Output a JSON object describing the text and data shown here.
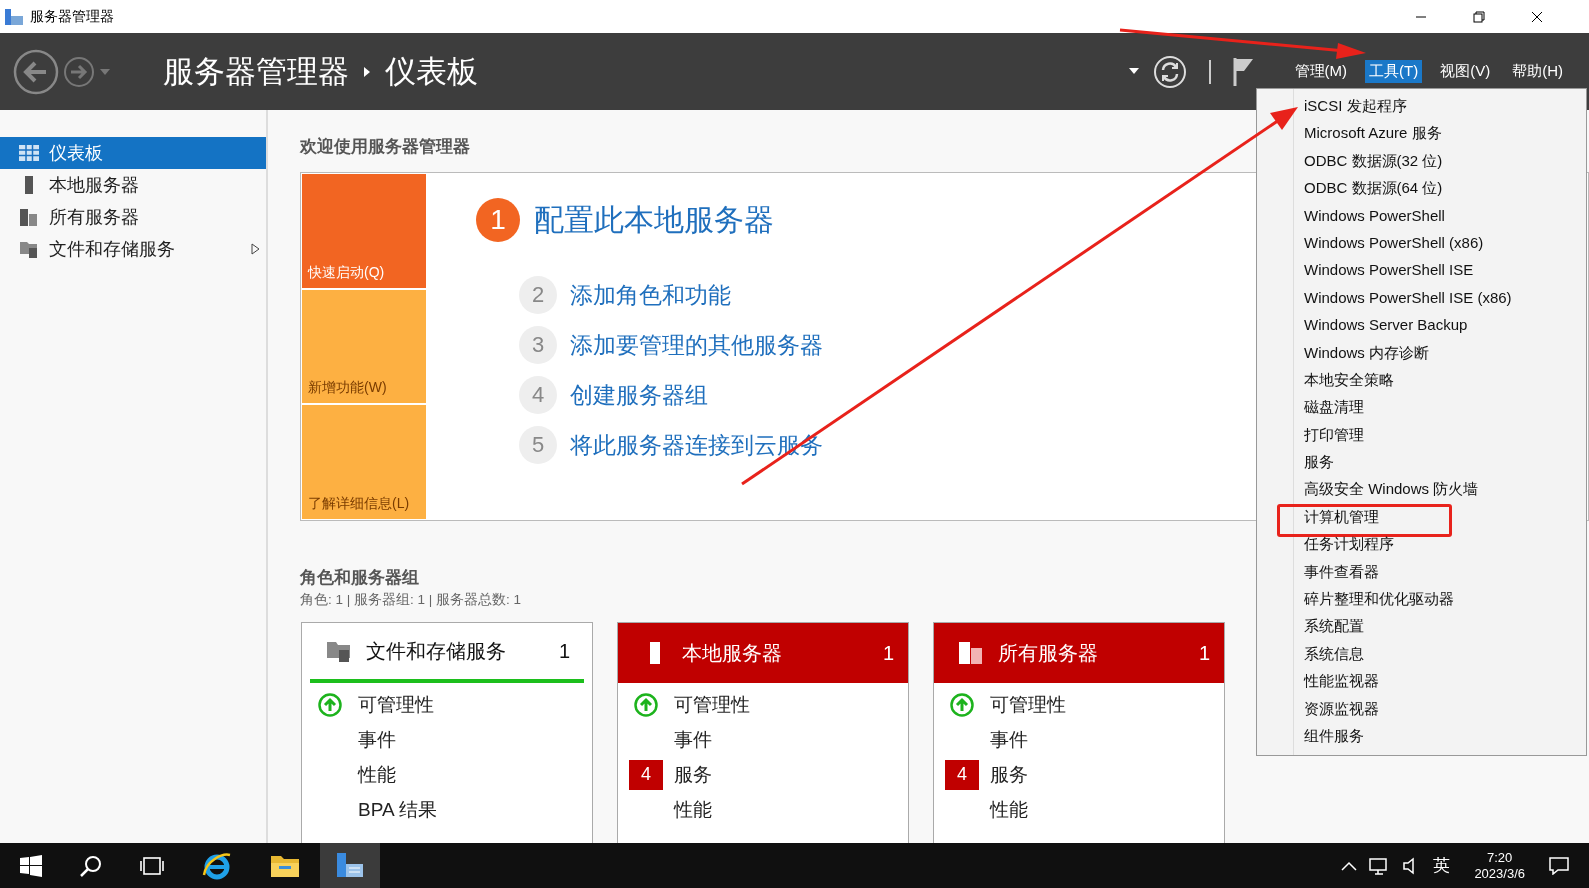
{
  "window": {
    "title": "服务器管理器"
  },
  "header": {
    "breadcrumb": [
      "服务器管理器",
      "仪表板"
    ],
    "menus": [
      {
        "label": "管理(M)",
        "selected": false
      },
      {
        "label": "工具(T)",
        "selected": true
      },
      {
        "label": "视图(V)",
        "selected": false
      },
      {
        "label": "帮助(H)",
        "selected": false
      }
    ]
  },
  "sidebar": {
    "items": [
      {
        "label": "仪表板",
        "kind": "dashboard",
        "selected": true,
        "has_submenu": false
      },
      {
        "label": "本地服务器",
        "kind": "server",
        "selected": false,
        "has_submenu": false
      },
      {
        "label": "所有服务器",
        "kind": "servers",
        "selected": false,
        "has_submenu": false
      },
      {
        "label": "文件和存储服务",
        "kind": "files",
        "selected": false,
        "has_submenu": true
      }
    ]
  },
  "welcome": {
    "title": "欢迎使用服务器管理器",
    "tiles": [
      {
        "label": "快速启动(Q)",
        "selected": true
      },
      {
        "label": "新增功能(W)",
        "selected": false
      },
      {
        "label": "了解详细信息(L)",
        "selected": false
      }
    ],
    "main_step": {
      "number": "1",
      "label": "配置此本地服务器"
    },
    "steps": [
      {
        "number": "2",
        "label": "添加角色和功能"
      },
      {
        "number": "3",
        "label": "添加要管理的其他服务器"
      },
      {
        "number": "4",
        "label": "创建服务器组"
      },
      {
        "number": "5",
        "label": "将此服务器连接到云服务"
      }
    ]
  },
  "roles": {
    "title": "角色和服务器组",
    "summary": "角色: 1 | 服务器组: 1 | 服务器总数: 1",
    "cards": [
      {
        "title": "文件和存储服务",
        "count": "1",
        "alert": false,
        "kind": "files",
        "rows": [
          {
            "kind": "status",
            "label": "可管理性"
          },
          {
            "kind": "plain",
            "label": "事件"
          },
          {
            "kind": "plain",
            "label": "性能"
          },
          {
            "kind": "plain",
            "label": "BPA 结果"
          }
        ]
      },
      {
        "title": "本地服务器",
        "count": "1",
        "alert": true,
        "kind": "server",
        "rows": [
          {
            "kind": "status",
            "label": "可管理性"
          },
          {
            "kind": "plain",
            "label": "事件"
          },
          {
            "kind": "badge",
            "badge": "4",
            "label": "服务"
          },
          {
            "kind": "plain",
            "label": "性能"
          }
        ]
      },
      {
        "title": "所有服务器",
        "count": "1",
        "alert": true,
        "kind": "servers",
        "rows": [
          {
            "kind": "status",
            "label": "可管理性"
          },
          {
            "kind": "plain",
            "label": "事件"
          },
          {
            "kind": "badge",
            "badge": "4",
            "label": "服务"
          },
          {
            "kind": "plain",
            "label": "性能"
          }
        ]
      }
    ]
  },
  "tools_menu": {
    "items": [
      {
        "label": "iSCSI 发起程序",
        "highlighted": false
      },
      {
        "label": "Microsoft Azure 服务",
        "highlighted": false
      },
      {
        "label": "ODBC 数据源(32 位)",
        "highlighted": false
      },
      {
        "label": "ODBC 数据源(64 位)",
        "highlighted": false
      },
      {
        "label": "Windows PowerShell",
        "highlighted": false
      },
      {
        "label": "Windows PowerShell (x86)",
        "highlighted": false
      },
      {
        "label": "Windows PowerShell ISE",
        "highlighted": false
      },
      {
        "label": "Windows PowerShell ISE (x86)",
        "highlighted": false
      },
      {
        "label": "Windows Server Backup",
        "highlighted": false
      },
      {
        "label": "Windows 内存诊断",
        "highlighted": false
      },
      {
        "label": "本地安全策略",
        "highlighted": false
      },
      {
        "label": "磁盘清理",
        "highlighted": false
      },
      {
        "label": "打印管理",
        "highlighted": false
      },
      {
        "label": "服务",
        "highlighted": false
      },
      {
        "label": "高级安全 Windows 防火墙",
        "highlighted": false
      },
      {
        "label": "计算机管理",
        "highlighted": true
      },
      {
        "label": "任务计划程序",
        "highlighted": false
      },
      {
        "label": "事件查看器",
        "highlighted": false
      },
      {
        "label": "碎片整理和优化驱动器",
        "highlighted": false
      },
      {
        "label": "系统配置",
        "highlighted": false
      },
      {
        "label": "系统信息",
        "highlighted": false
      },
      {
        "label": "性能监视器",
        "highlighted": false
      },
      {
        "label": "资源监视器",
        "highlighted": false
      },
      {
        "label": "组件服务",
        "highlighted": false
      }
    ]
  },
  "taskbar": {
    "ime": "英",
    "time": "7:20",
    "date": "2023/3/6"
  }
}
